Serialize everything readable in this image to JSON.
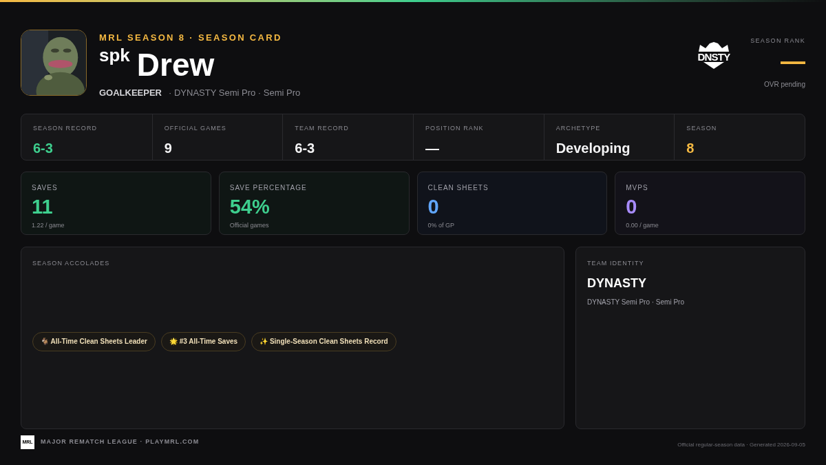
{
  "header": {
    "eyebrow": "MRL SEASON 8 · SEASON CARD",
    "tag": "spk",
    "name": "Drew",
    "position": "GOALKEEPER",
    "team_line": "· DYNASTY Semi Pro · Semi Pro",
    "team_logo": "DNSTY",
    "rank_label": "SEASON RANK",
    "rank_value": "—",
    "rank_note": "OVR pending"
  },
  "summary": [
    {
      "label": "SEASON RECORD",
      "value": "6-3",
      "color": "#3ecf8e"
    },
    {
      "label": "OFFICIAL GAMES",
      "value": "9",
      "color": "#f4f4f5"
    },
    {
      "label": "TEAM RECORD",
      "value": "6-3",
      "color": "#f4f4f5"
    },
    {
      "label": "POSITION RANK",
      "value": "—",
      "color": "#f4f4f5"
    },
    {
      "label": "ARCHETYPE",
      "value": "Developing",
      "color": "#f4f4f5"
    },
    {
      "label": "SEASON",
      "value": "8",
      "color": "#f5b942"
    }
  ],
  "stats": [
    {
      "label": "SAVES",
      "value": "11",
      "sub": "1.22 / game",
      "color": "#3ecf8e"
    },
    {
      "label": "SAVE PERCENTAGE",
      "value": "54%",
      "sub": "Official games",
      "color": "#3ecf8e"
    },
    {
      "label": "CLEAN SHEETS",
      "value": "0",
      "sub": "0% of GP",
      "color": "#60a5fa"
    },
    {
      "label": "MVPS",
      "value": "0",
      "sub": "0.00 / game",
      "color": "#a78bfa"
    }
  ],
  "accolades": {
    "title": "SEASON ACCOLADES",
    "items": [
      {
        "icon": "🐐",
        "label": "All-Time Clean Sheets Leader"
      },
      {
        "icon": "🌟",
        "label": "#3 All-Time Saves"
      },
      {
        "icon": "✨",
        "label": "Single-Season Clean Sheets Record"
      }
    ]
  },
  "team_identity": {
    "title": "TEAM IDENTITY",
    "name": "DYNASTY",
    "sub": "DYNASTY Semi Pro · Semi Pro"
  },
  "footer": {
    "logo": "MRL",
    "league": "MAJOR REMATCH LEAGUE · PLAYMRL.COM",
    "note": "Official regular-season data · Generated 2026-09-05"
  }
}
